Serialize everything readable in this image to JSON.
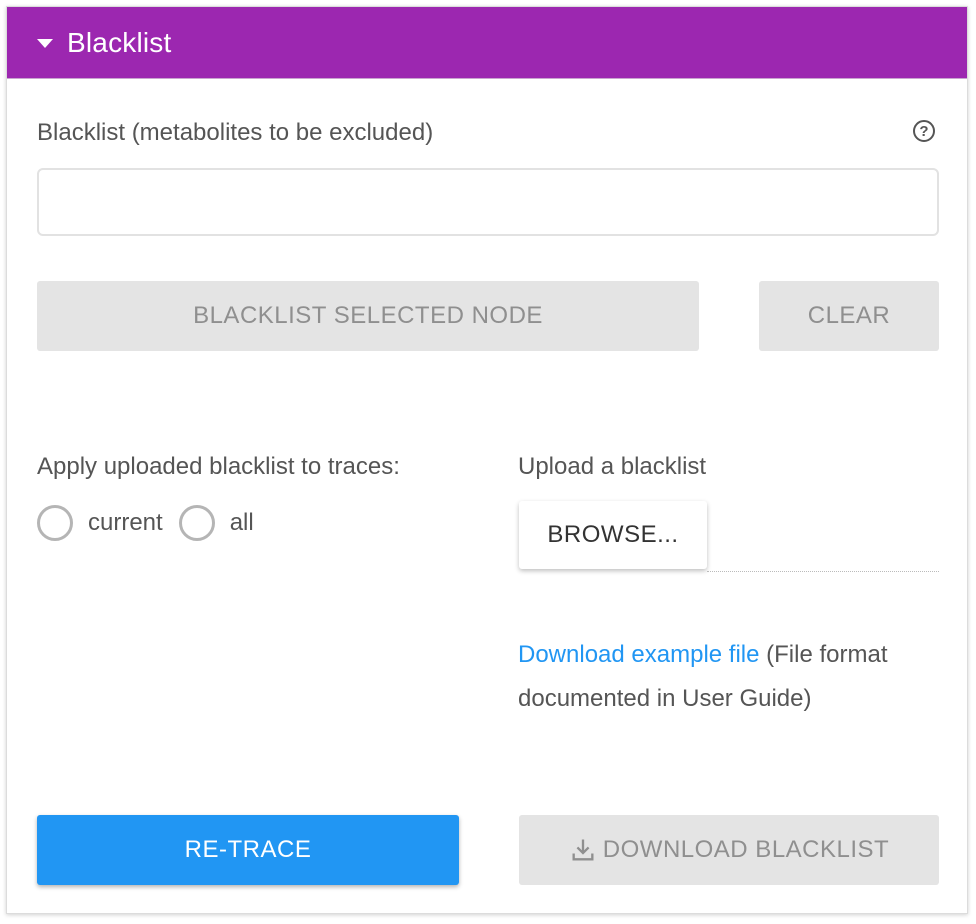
{
  "panel": {
    "title": "Blacklist"
  },
  "blacklist_field": {
    "label": "Blacklist (metabolites to be excluded)",
    "value": "",
    "placeholder": "",
    "help_icon_glyph": "?"
  },
  "buttons": {
    "blacklist_selected_node": "BLACKLIST SELECTED NODE",
    "clear": "CLEAR",
    "browse": "BROWSE...",
    "retrace": "RE-TRACE",
    "download_blacklist": "DOWNLOAD BLACKLIST"
  },
  "apply": {
    "label": "Apply uploaded blacklist to traces:",
    "options": [
      {
        "label": "current",
        "selected": false
      },
      {
        "label": "all",
        "selected": false
      }
    ]
  },
  "upload": {
    "label": "Upload a blacklist"
  },
  "example": {
    "link_text": "Download example file",
    "note": " (File format documented in User Guide)"
  },
  "icons": {
    "header": "caret-down-icon",
    "help": "help-circle-icon",
    "download": "download-icon"
  },
  "colors": {
    "header_bg": "#9c27b0",
    "primary_button": "#2196f3",
    "disabled_button": "#e4e4e4",
    "link": "#2196f3"
  }
}
